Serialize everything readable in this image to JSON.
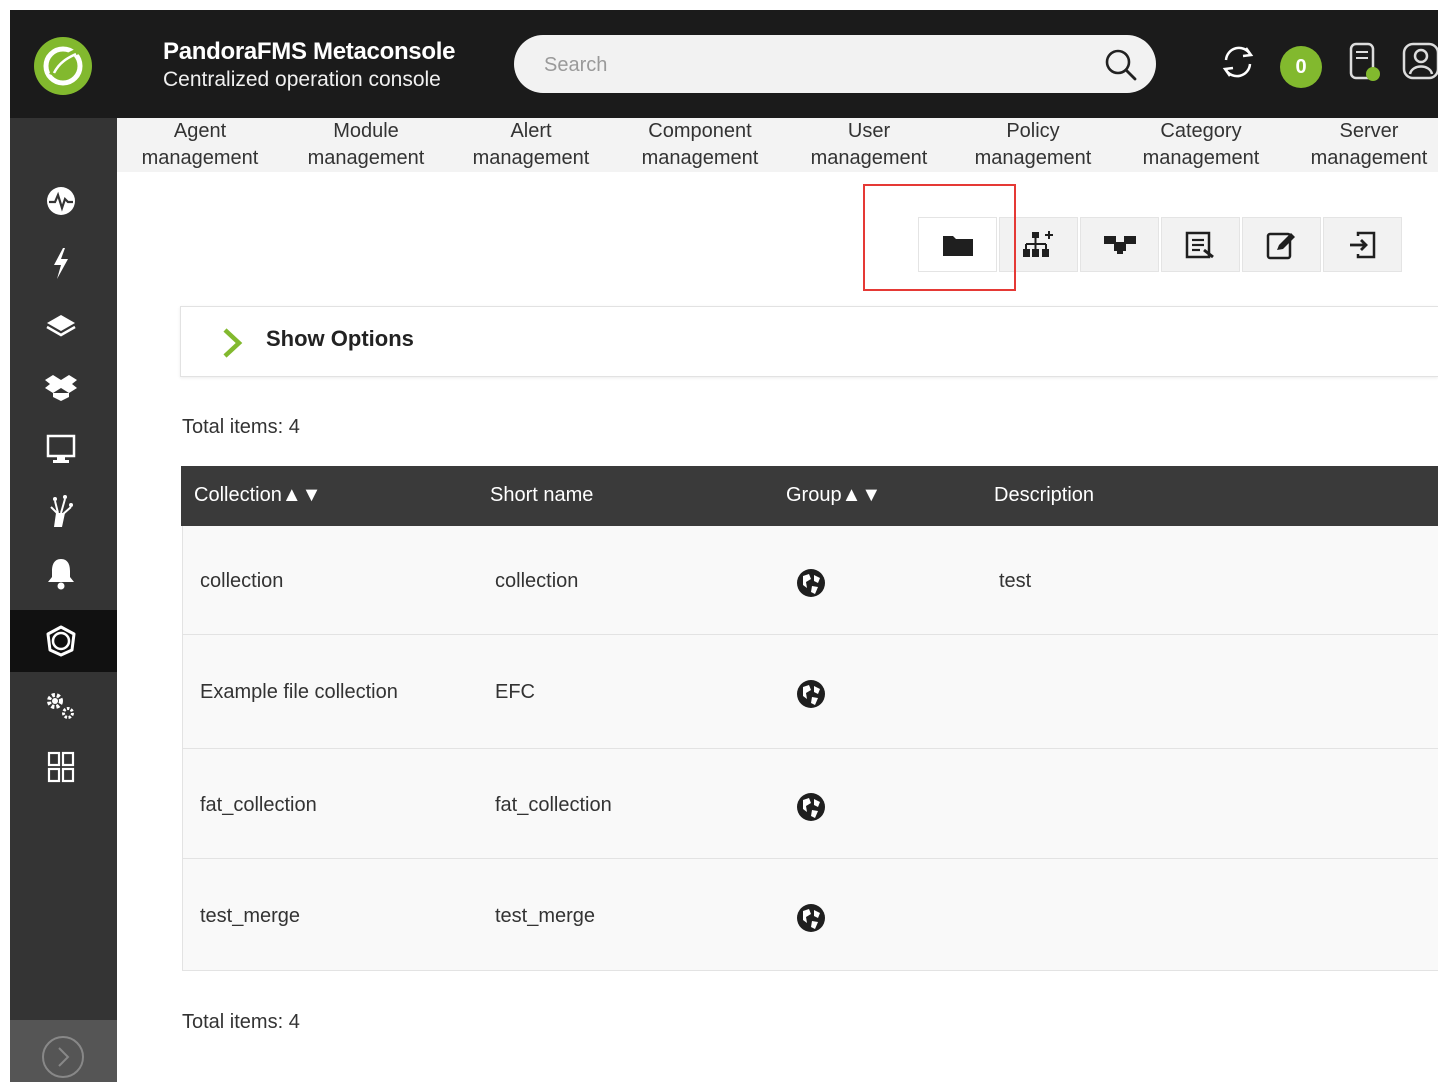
{
  "header": {
    "title": "PandoraFMS Metaconsole",
    "subtitle": "Centralized operation console",
    "search_placeholder": "Search",
    "notification_count": "0"
  },
  "sidebar": {
    "items": [
      {
        "name": "monitoring",
        "icon": "pulse-icon"
      },
      {
        "name": "events",
        "icon": "lightning-icon"
      },
      {
        "name": "reporting",
        "icon": "layers-icon"
      },
      {
        "name": "resources",
        "icon": "box-icon"
      },
      {
        "name": "screens",
        "icon": "monitor-icon"
      },
      {
        "name": "tools",
        "icon": "network-icon"
      },
      {
        "name": "alerts",
        "icon": "bell-icon"
      },
      {
        "name": "centralised-management",
        "icon": "pandora-logo-icon",
        "active": true
      },
      {
        "name": "setup",
        "icon": "gears-icon"
      },
      {
        "name": "extensions",
        "icon": "grid-icon"
      }
    ]
  },
  "submenu": {
    "items": [
      {
        "line1": "Agent",
        "line2": "management"
      },
      {
        "line1": "Module",
        "line2": "management"
      },
      {
        "line1": "Alert",
        "line2": "management"
      },
      {
        "line1": "Component",
        "line2": "management"
      },
      {
        "line1": "User",
        "line2": "management"
      },
      {
        "line1": "Policy",
        "line2": "management"
      },
      {
        "line1": "Category",
        "line2": "management"
      },
      {
        "line1": "Server",
        "line2": "management"
      }
    ]
  },
  "toolbar": {
    "buttons": [
      "folder-icon",
      "add-network-icon",
      "network-icon",
      "list-icon",
      "edit-icon",
      "logout-icon"
    ],
    "active_index": 0
  },
  "options": {
    "label": "Show Options"
  },
  "total_top": "Total items: 4",
  "total_bottom": "Total items: 4",
  "table": {
    "headers": [
      "Collection",
      "Short name",
      "Group",
      "Description"
    ],
    "sort_arrows": "▲▼",
    "rows": [
      {
        "collection": "collection",
        "short_name": "collection",
        "group_icon": "globe-icon",
        "description": "test"
      },
      {
        "collection": "Example file collection",
        "short_name": "EFC",
        "group_icon": "globe-icon",
        "description": ""
      },
      {
        "collection": "fat_collection",
        "short_name": "fat_collection",
        "group_icon": "globe-icon",
        "description": ""
      },
      {
        "collection": "test_merge",
        "short_name": "test_merge",
        "group_icon": "globe-icon",
        "description": ""
      }
    ]
  },
  "colors": {
    "brand_green": "#82b92e",
    "header_bg": "#1b1b1b",
    "sidebar_bg": "#343434",
    "highlight_red": "#e53935"
  }
}
